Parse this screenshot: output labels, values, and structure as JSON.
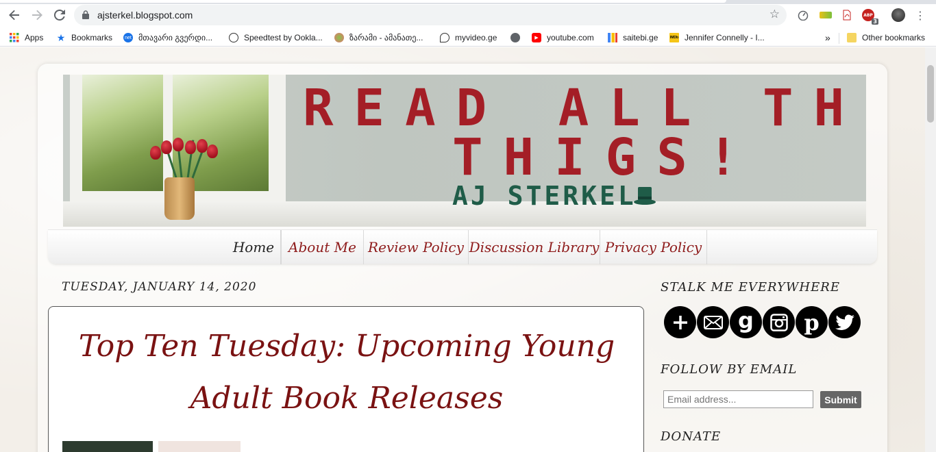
{
  "browser": {
    "url": "ajsterkel.blogspot.com",
    "bookmarks": [
      {
        "label": "Apps",
        "icon": "apps-grid-icon"
      },
      {
        "label": "Bookmarks",
        "icon": "star-icon"
      },
      {
        "label": "მთავარი გვერდი...",
        "icon": "net-icon"
      },
      {
        "label": "Speedtest by Ookla...",
        "icon": "speedtest-icon"
      },
      {
        "label": "ზარამი - ამანათე...",
        "icon": "globe-icon"
      },
      {
        "label": "myvideo.ge",
        "icon": "myvideo-icon"
      },
      {
        "label": "",
        "icon": "world-icon"
      },
      {
        "label": "youtube.com",
        "icon": "youtube-icon"
      },
      {
        "label": "saitebi.ge",
        "icon": "saitebi-icon"
      },
      {
        "label": "Jennifer Connelly - I...",
        "icon": "imdb-icon"
      }
    ],
    "overflow": "»",
    "other_bookmarks": "Other bookmarks",
    "ext_badge": "3"
  },
  "blog": {
    "header": {
      "title_line1": "READ ALL THE",
      "title_line2": "THIGS!",
      "author": "AJ STERKEL"
    },
    "nav_tabs": [
      "Home",
      "About Me",
      "Review Policy",
      "Discussion Library",
      "Privacy Policy"
    ],
    "date_header": "TUESDAY, JANUARY 14, 2020",
    "post_title": "Top Ten Tuesday: Upcoming Young Adult Book Releases",
    "sidebar": {
      "social_heading": "STALK ME EVERYWHERE",
      "social_icons": [
        "plus-icon",
        "mail-icon",
        "goodreads-icon",
        "instagram-icon",
        "pinterest-icon",
        "twitter-icon"
      ],
      "follow_heading": "FOLLOW BY EMAIL",
      "email_placeholder": "Email address...",
      "submit_label": "Submit",
      "donate_heading": "DONATE"
    }
  },
  "colors": {
    "title_red": "#a41e26",
    "author_green": "#1f5c48",
    "post_title": "#7a1212",
    "tab_text": "#8e1b1b"
  }
}
